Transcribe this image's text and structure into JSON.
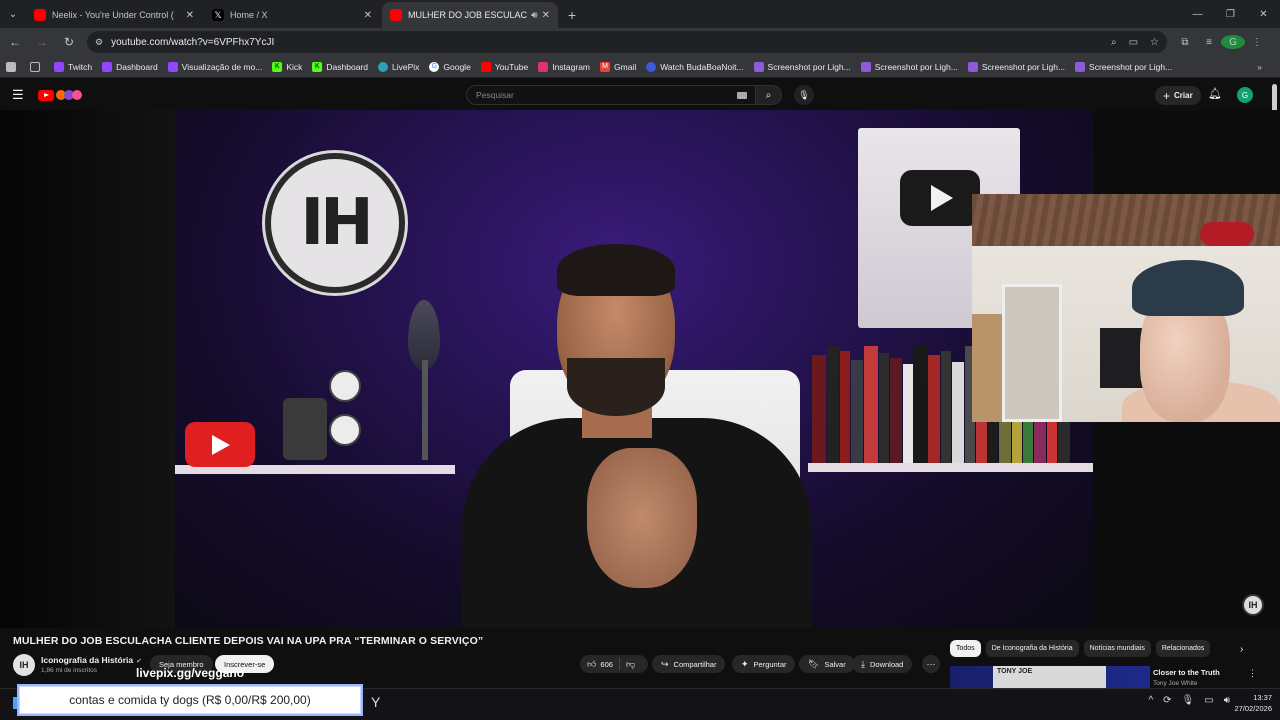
{
  "browser": {
    "tabs": [
      {
        "title": "Neelix - You're Under Control (",
        "favicon_color": "#ff0000",
        "active": false
      },
      {
        "title": "Home / X",
        "favicon_color": "#000000",
        "active": false
      },
      {
        "title": "MULHER DO JOB ESCULAC",
        "favicon_color": "#ff0000",
        "active": true
      }
    ],
    "url": "youtube.com/watch?v=6VPFhx7YcJI",
    "profile_initial": "G",
    "bookmarks": [
      {
        "label": "Twitch",
        "color": "#9146ff"
      },
      {
        "label": "Dashboard",
        "color": "#9146ff"
      },
      {
        "label": "Visualização de mo...",
        "color": "#9146ff"
      },
      {
        "label": "Kick",
        "color": "#53fc18"
      },
      {
        "label": "Dashboard",
        "color": "#53fc18"
      },
      {
        "label": "LivePix",
        "color": "#2aa3b7"
      },
      {
        "label": "Google",
        "color": "#ffffff"
      },
      {
        "label": "YouTube",
        "color": "#ff0000"
      },
      {
        "label": "Instagram",
        "color": "#e1306c"
      },
      {
        "label": "Gmail",
        "color": "#ea4335"
      },
      {
        "label": "Watch BudaBoaNoit...",
        "color": "#3b5bdb"
      },
      {
        "label": "Screenshot por Ligh...",
        "color": "#8e5bd8"
      },
      {
        "label": "Screenshot por Ligh...",
        "color": "#8e5bd8"
      },
      {
        "label": "Screenshot por Ligh...",
        "color": "#8e5bd8"
      },
      {
        "label": "Screenshot por Ligh...",
        "color": "#8e5bd8"
      }
    ]
  },
  "youtube": {
    "search_placeholder": "Pesquisar",
    "create_label": "Criar",
    "avatar_initial": "G",
    "video_watermark": "IH",
    "logo_text": "IH",
    "video": {
      "title": "MULHER DO JOB ESCULACHA CLIENTE DEPOIS VAI NA UPA PRA “TERMINAR O SERVIÇO”",
      "channel": "Iconografia da História",
      "channel_initials": "IH",
      "subscribers": "1,86 mi de inscritos",
      "join_label": "Seja membro",
      "subscribe_label": "Inscrever-se",
      "likes": "606",
      "share_label": "Compartilhar",
      "ask_label": "Perguntar",
      "save_label": "Salvar",
      "download_label": "Download"
    },
    "chips": [
      "Todos",
      "De Iconografia da História",
      "Notícias mundiais",
      "Relacionados"
    ],
    "suggestion": {
      "title": "Closer to the Truth",
      "channel": "Tony Joe White",
      "thumb_text": "TONY JOE"
    }
  },
  "overlay": {
    "livepix_text": "livepix.gg/veggano",
    "donation_text": "contas e comida ty dogs (R$ 0,00/R$ 200,00)"
  },
  "taskbar": {
    "time": "13:37",
    "date": "27/02/2026"
  }
}
